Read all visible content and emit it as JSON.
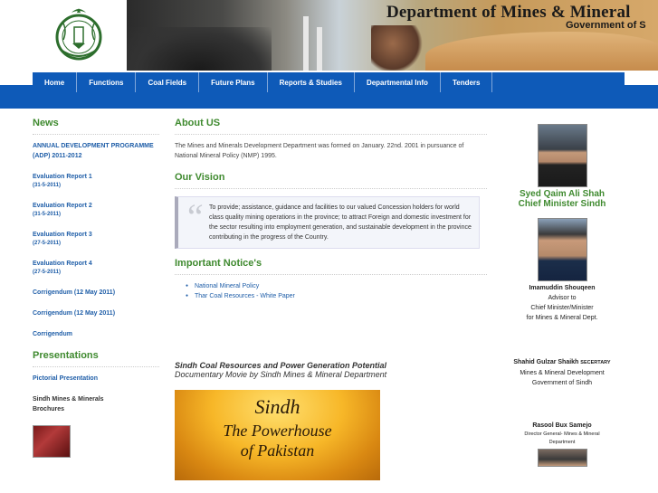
{
  "header": {
    "title": "Department of Mines & Mineral",
    "subtitle": "Government of S"
  },
  "nav": {
    "items": [
      "Home",
      "Functions",
      "Coal Fields",
      "Future Plans",
      "Reports & Studies",
      "Departmental Info",
      "Tenders"
    ]
  },
  "left": {
    "news_heading": "News",
    "news": [
      {
        "title": "ANNUAL DEVELOPMENT PROGRAMME (ADP) 2011-2012",
        "date": ""
      },
      {
        "title": "Evaluation Report 1",
        "date": "(31-5-2011)"
      },
      {
        "title": "Evaluation Report 2",
        "date": "(31-5-2011)"
      },
      {
        "title": "Evaluation Report 3",
        "date": "(27-5-2011)"
      },
      {
        "title": "Evaluation Report 4",
        "date": "(27-5-2011)"
      },
      {
        "title": "Corrigendum (12 May 2011)",
        "date": ""
      },
      {
        "title": "Corrigendum (12 May 2011)",
        "date": ""
      },
      {
        "title": "Corrigendum",
        "date": ""
      }
    ],
    "presentations_heading": "Presentations",
    "presentations": [
      "Pictorial Presentation"
    ],
    "brochures_label": "Sindh Mines & Minerals Brochures"
  },
  "main": {
    "about_heading": "About US",
    "about_text": "The Mines and Minerals Development Department was formed on January. 22nd. 2001 in pursuance of National Mineral Policy (NMP) 1995.",
    "vision_heading": "Our Vision",
    "vision_text": "To provide; assistance, guidance and facilities to our valued Concession holders for world class quality mining operations in the province; to attract Foreign and domestic investment for the sector resulting into employment generation, and sustainable development in the province contributing in the progress of the Country.",
    "notices_heading": "Important Notice's",
    "notices": [
      "National Mineral Policy",
      "Thar Coal Resources - White Paper"
    ],
    "video_title": "Sindh Coal Resources and Power Generation Potential",
    "video_subtitle": "Documentary Movie by Sindh Mines & Mineral Department",
    "poster_line1": "Sindh",
    "poster_line2": "The Powerhouse",
    "poster_line3": "of Pakistan"
  },
  "right": {
    "cm_name": "Syed Qaim Ali Shah",
    "cm_title": "Chief Minister Sindh",
    "advisor_name": "Imamuddin Shouqeen",
    "advisor_line1": "Advisor to",
    "advisor_line2": "Chief Minister/Minister",
    "advisor_line3": "for Mines & Mineral Dept.",
    "secretary_name": "Shahid Gulzar Shaikh",
    "secretary_role": "SECERTARY",
    "secretary_line1": "Mines & Mineral Development",
    "secretary_line2": "Government of Sindh",
    "dg_name": "Rasool Bux Samejo",
    "dg_line1": "Director General- Mines & Mineral",
    "dg_line2": "Department"
  }
}
